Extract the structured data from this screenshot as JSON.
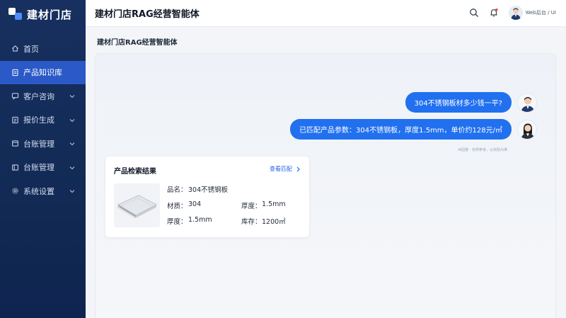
{
  "sidebar": {
    "logo_text": "建材门店",
    "items": [
      {
        "label": "首页",
        "active": false,
        "has_submenu": false
      },
      {
        "label": "产品知识库",
        "active": true,
        "has_submenu": false
      },
      {
        "label": "客户咨询",
        "active": false,
        "has_submenu": true
      },
      {
        "label": "报价生成",
        "active": false,
        "has_submenu": true
      },
      {
        "label": "台账管理",
        "active": false,
        "has_submenu": true
      },
      {
        "label": "台账管理",
        "active": false,
        "has_submenu": true
      },
      {
        "label": "系统设置",
        "active": false,
        "has_submenu": true
      }
    ]
  },
  "header": {
    "title": "建材门店RAG经营智能体",
    "user_name": "Web后台 / UI"
  },
  "page": {
    "subtitle": "建材门店RAG经营智能体"
  },
  "chat": {
    "user_message": "304不锈钢板材多少钱一平?",
    "ai_message": "已匹配产品参数：304不锈钢板，厚度1.5mm，单价约128元/㎡",
    "footnote": "AI回答 · 仅供参考，以实际为准"
  },
  "result_card": {
    "title": "产品检索结果",
    "link_label": "查看匹配",
    "name_label": "品名：",
    "name_value": "304不锈钢板",
    "material_label": "材质：",
    "material_value": "304",
    "thickness_label": "厚度：",
    "thickness_value": "1.5mm",
    "thickness2_label": "厚度：",
    "thickness2_value": "1.5mm",
    "stock_label": "库存：",
    "stock_value": "1200㎡"
  },
  "colors": {
    "sidebar_bg": "#17305f",
    "active_item": "#2b5ac8",
    "bubble": "#2170f0",
    "link": "#2563eb"
  }
}
